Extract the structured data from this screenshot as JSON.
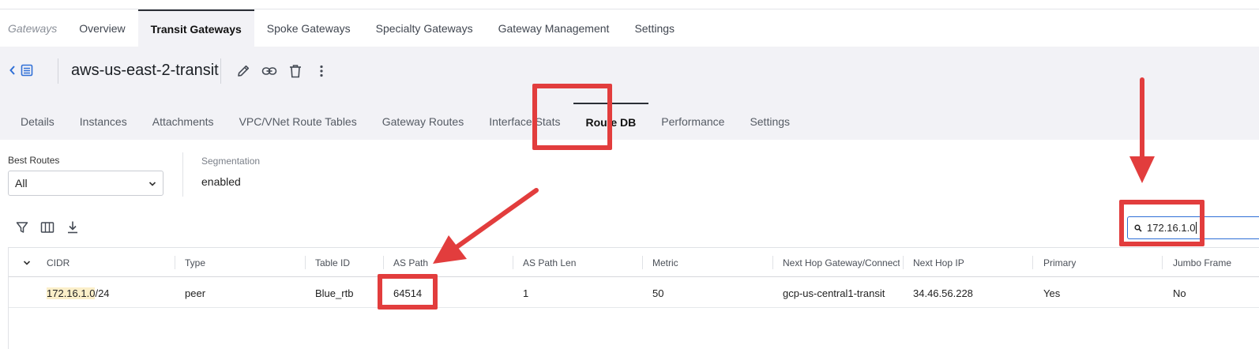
{
  "topnav": {
    "breadcrumb": "Gateways",
    "tabs": [
      {
        "label": "Overview"
      },
      {
        "label": "Transit Gateways",
        "active": true
      },
      {
        "label": "Spoke Gateways"
      },
      {
        "label": "Specialty Gateways"
      },
      {
        "label": "Gateway Management"
      },
      {
        "label": "Settings"
      }
    ]
  },
  "gateway": {
    "title": "aws-us-east-2-transit",
    "actions": [
      "edit-icon",
      "link-icon",
      "trash-icon",
      "more-vertical-icon"
    ]
  },
  "subtabs": [
    {
      "label": "Details"
    },
    {
      "label": "Instances"
    },
    {
      "label": "Attachments"
    },
    {
      "label": "VPC/VNet Route Tables"
    },
    {
      "label": "Gateway Routes"
    },
    {
      "label": "Interface Stats"
    },
    {
      "label": "Route DB",
      "active": true
    },
    {
      "label": "Performance"
    },
    {
      "label": "Settings"
    }
  ],
  "filters": {
    "best_routes_label": "Best Routes",
    "best_routes_value": "All",
    "segmentation_label": "Segmentation",
    "segmentation_value": "enabled"
  },
  "toolbar_icons": [
    "filter-icon",
    "columns-icon",
    "download-icon"
  ],
  "search": {
    "value": "172.16.1.0"
  },
  "table": {
    "columns": [
      "CIDR",
      "Type",
      "Table ID",
      "AS Path",
      "AS Path Len",
      "Metric",
      "Next Hop Gateway/Connectio",
      "Next Hop IP",
      "Primary",
      "Jumbo Frame"
    ],
    "rows": [
      {
        "cidr_match": "172.16.1.0",
        "cidr_rest": "/24",
        "type": "peer",
        "table_id": "Blue_rtb",
        "as_path": "64514",
        "as_path_len": "1",
        "metric": "50",
        "next_hop_gateway": "gcp-us-central1-transit",
        "next_hop_ip": "34.46.56.228",
        "primary": "Yes",
        "jumbo_frame": "No"
      }
    ]
  },
  "colors": {
    "accent": "#2f6fd6",
    "annotation_red": "#e23d3d",
    "band_gray": "#f2f2f6",
    "highlight": "#fbefc9"
  }
}
